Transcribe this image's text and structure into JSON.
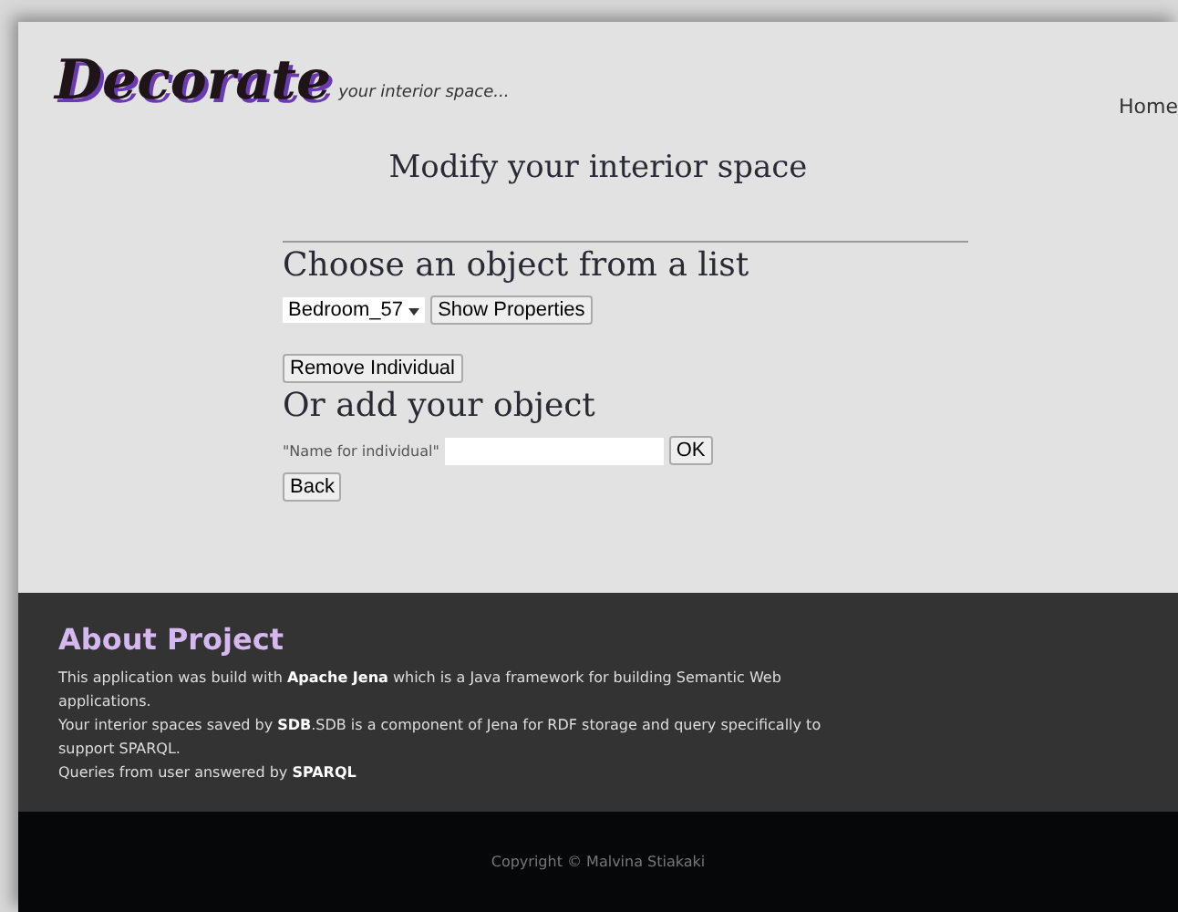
{
  "header": {
    "logo": "Decorate",
    "tagline": "your interior space...",
    "nav": [
      "Home"
    ]
  },
  "page_title": "Modify your interior space",
  "choose": {
    "heading": "Choose an object from a list",
    "select_value": "Bedroom_57",
    "show_button": "Show Properties",
    "remove_button": "Remove Individual"
  },
  "add": {
    "heading": "Or add your object",
    "label": "\"Name for individual\"",
    "ok_button": "OK",
    "back_button": "Back"
  },
  "about": {
    "heading": "About Project",
    "paragraphs": [
      "This application was build with **Apache Jena** which is a Java framework for building Semantic Web applications.",
      "Your interior spaces saved by **SDB**.SDB is a component of Jena for RDF storage and query specifically to support SPARQL.",
      "Queries from user answered by **SPARQL**"
    ]
  },
  "copyright": "Copyright © Malvina Stiakaki"
}
